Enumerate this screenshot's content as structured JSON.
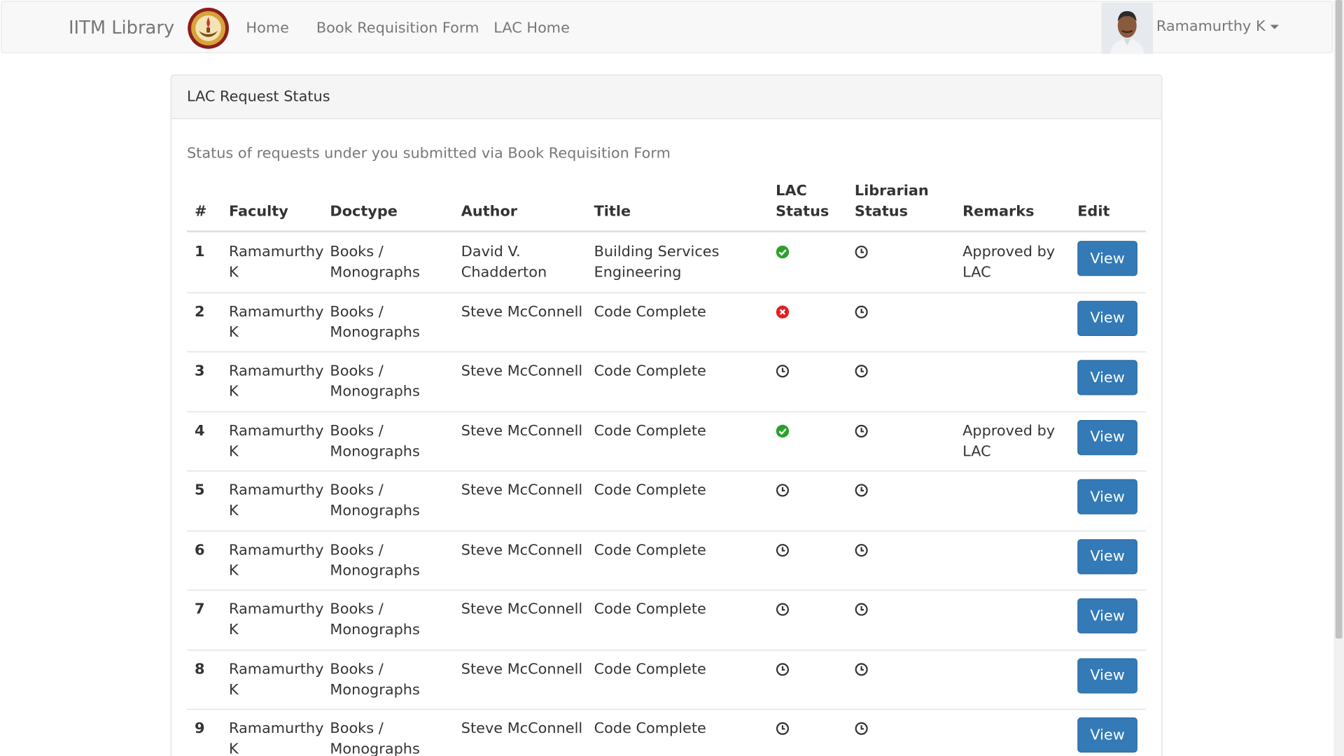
{
  "navbar": {
    "brand": "IITM Library",
    "links": [
      "Home",
      "Book Requisition Form",
      "LAC Home"
    ],
    "user_name": "Ramamurthy K"
  },
  "panel": {
    "title": "LAC Request Status",
    "subtitle": "Status of requests under you submitted via Book Requisition Form"
  },
  "table": {
    "headers": {
      "num": "#",
      "faculty": "Faculty",
      "doctype": "Doctype",
      "author": "Author",
      "title": "Title",
      "lac_status_1": "LAC",
      "lac_status_2": "Status",
      "librarian_status_1": "Librarian",
      "librarian_status_2": "Status",
      "remarks": "Remarks",
      "edit": "Edit"
    },
    "view_label": "View",
    "status_icons": {
      "approved": "check-circle-icon",
      "rejected": "times-circle-icon",
      "pending": "clock-icon"
    },
    "colors": {
      "approved": "#2ca02c",
      "rejected": "#e02020",
      "button": "#337ab7"
    },
    "rows": [
      {
        "num": "1",
        "faculty": [
          "Ramamurthy",
          "K"
        ],
        "doctype": [
          "Books /",
          "Monographs"
        ],
        "author": [
          "David V.",
          "Chadderton"
        ],
        "title": [
          "Building Services",
          "Engineering"
        ],
        "lac_status": "approved",
        "librarian_status": "pending",
        "remarks": [
          "Approved by",
          "LAC"
        ]
      },
      {
        "num": "2",
        "faculty": [
          "Ramamurthy",
          "K"
        ],
        "doctype": [
          "Books /",
          "Monographs"
        ],
        "author": [
          "Steve McConnell"
        ],
        "title": [
          "Code Complete"
        ],
        "lac_status": "rejected",
        "librarian_status": "pending",
        "remarks": []
      },
      {
        "num": "3",
        "faculty": [
          "Ramamurthy",
          "K"
        ],
        "doctype": [
          "Books /",
          "Monographs"
        ],
        "author": [
          "Steve McConnell"
        ],
        "title": [
          "Code Complete"
        ],
        "lac_status": "pending",
        "librarian_status": "pending",
        "remarks": []
      },
      {
        "num": "4",
        "faculty": [
          "Ramamurthy",
          "K"
        ],
        "doctype": [
          "Books /",
          "Monographs"
        ],
        "author": [
          "Steve McConnell"
        ],
        "title": [
          "Code Complete"
        ],
        "lac_status": "approved",
        "librarian_status": "pending",
        "remarks": [
          "Approved by",
          "LAC"
        ]
      },
      {
        "num": "5",
        "faculty": [
          "Ramamurthy",
          "K"
        ],
        "doctype": [
          "Books /",
          "Monographs"
        ],
        "author": [
          "Steve McConnell"
        ],
        "title": [
          "Code Complete"
        ],
        "lac_status": "pending",
        "librarian_status": "pending",
        "remarks": []
      },
      {
        "num": "6",
        "faculty": [
          "Ramamurthy",
          "K"
        ],
        "doctype": [
          "Books /",
          "Monographs"
        ],
        "author": [
          "Steve McConnell"
        ],
        "title": [
          "Code Complete"
        ],
        "lac_status": "pending",
        "librarian_status": "pending",
        "remarks": []
      },
      {
        "num": "7",
        "faculty": [
          "Ramamurthy",
          "K"
        ],
        "doctype": [
          "Books /",
          "Monographs"
        ],
        "author": [
          "Steve McConnell"
        ],
        "title": [
          "Code Complete"
        ],
        "lac_status": "pending",
        "librarian_status": "pending",
        "remarks": []
      },
      {
        "num": "8",
        "faculty": [
          "Ramamurthy",
          "K"
        ],
        "doctype": [
          "Books /",
          "Monographs"
        ],
        "author": [
          "Steve McConnell"
        ],
        "title": [
          "Code Complete"
        ],
        "lac_status": "pending",
        "librarian_status": "pending",
        "remarks": []
      },
      {
        "num": "9",
        "faculty": [
          "Ramamurthy",
          "K"
        ],
        "doctype": [
          "Books /",
          "Monographs"
        ],
        "author": [
          "Steve McConnell"
        ],
        "title": [
          "Code Complete"
        ],
        "lac_status": "pending",
        "librarian_status": "pending",
        "remarks": []
      }
    ]
  }
}
